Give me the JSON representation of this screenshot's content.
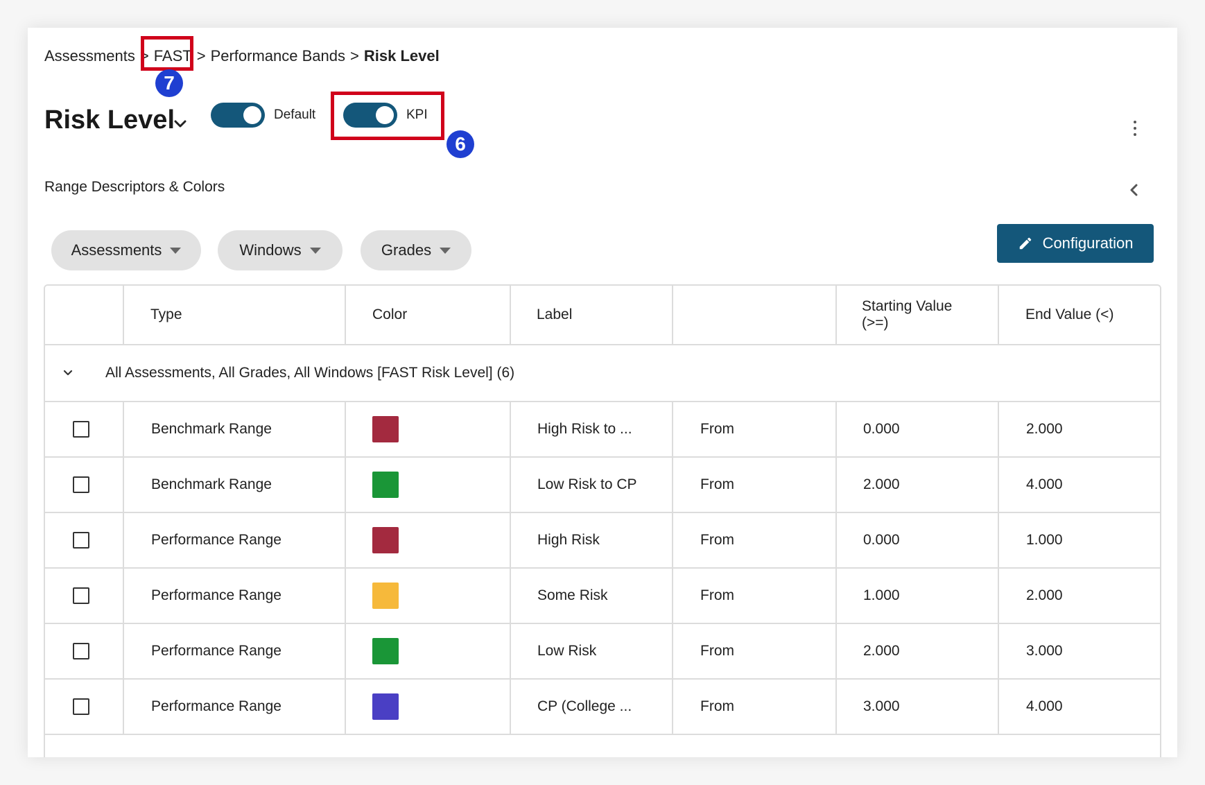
{
  "breadcrumb": {
    "items": [
      {
        "label": "Assessments"
      },
      {
        "label": "FAST"
      },
      {
        "label": "Performance Bands"
      },
      {
        "label": "Risk Level"
      }
    ],
    "separator": ">"
  },
  "annotations": {
    "fast_badge": "7",
    "kpi_badge": "6",
    "highlight_color": "#d0021b",
    "badge_color": "#1f3fd1"
  },
  "header": {
    "title": "Risk Level",
    "default_toggle": {
      "label": "Default",
      "on": true
    },
    "kpi_toggle": {
      "label": "KPI",
      "on": true
    }
  },
  "section": {
    "label": "Range Descriptors & Colors"
  },
  "filters": [
    {
      "label": "Assessments"
    },
    {
      "label": "Windows"
    },
    {
      "label": "Grades"
    }
  ],
  "config_button": {
    "label": "Configuration"
  },
  "colors": {
    "accent": "#14577a"
  },
  "table": {
    "columns": [
      "",
      "Type",
      "Color",
      "Label",
      "",
      "Starting Value (>=)",
      "End Value (<)"
    ],
    "group": {
      "label": "All Assessments, All Grades, All Windows [FAST Risk Level] (6)"
    },
    "rows": [
      {
        "type": "Benchmark Range",
        "color": "#a32a3f",
        "label": "High Risk to ...",
        "op": "From",
        "start": "0.000",
        "end": "2.000"
      },
      {
        "type": "Benchmark Range",
        "color": "#1a9637",
        "label": "Low Risk to CP",
        "op": "From",
        "start": "2.000",
        "end": "4.000"
      },
      {
        "type": "Performance Range",
        "color": "#a32a3f",
        "label": "High Risk",
        "op": "From",
        "start": "0.000",
        "end": "1.000"
      },
      {
        "type": "Performance Range",
        "color": "#f6b93b",
        "label": "Some Risk",
        "op": "From",
        "start": "1.000",
        "end": "2.000"
      },
      {
        "type": "Performance Range",
        "color": "#1a9637",
        "label": "Low Risk",
        "op": "From",
        "start": "2.000",
        "end": "3.000"
      },
      {
        "type": "Performance Range",
        "color": "#4a3fc4",
        "label": "CP (College ...",
        "op": "From",
        "start": "3.000",
        "end": "4.000"
      }
    ]
  }
}
